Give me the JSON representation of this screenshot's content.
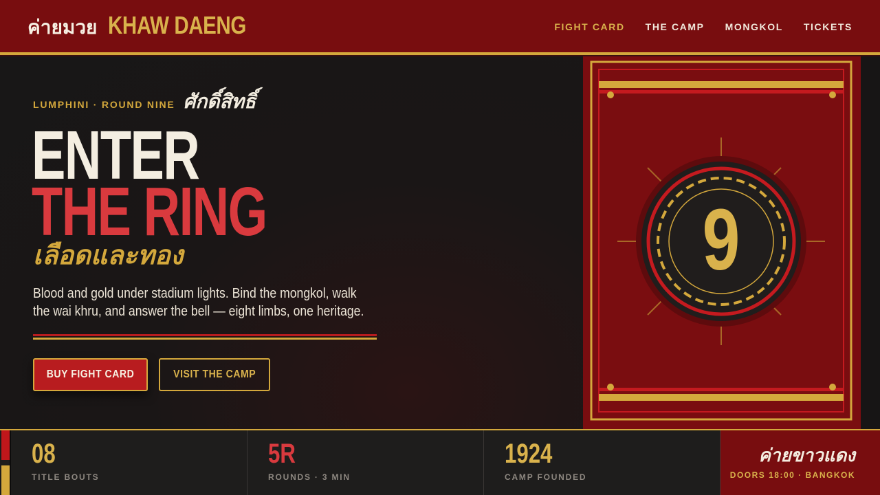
{
  "header": {
    "logo_thai": "ค่ายมวย",
    "logo_en": "KHAW DAENG",
    "nav": [
      {
        "label": "FIGHT CARD",
        "active": true
      },
      {
        "label": "THE CAMP",
        "active": false
      },
      {
        "label": "MONGKOL",
        "active": false
      },
      {
        "label": "TICKETS",
        "active": false
      }
    ]
  },
  "hero": {
    "kicker": "LUMPHINI · ROUND NINE",
    "kicker_thai": "ศักดิ์สิทธิ์",
    "title_line1": "ENTER",
    "title_line2": "THE RING",
    "title_thai": "เลือดและทอง",
    "lede": "Blood and gold under stadium lights. Bind the mongkol, walk the wai khru, and answer the bell — eight limbs, one heritage.",
    "buttons": {
      "primary": "BUY FIGHT CARD",
      "secondary": "VISIT THE CAMP"
    }
  },
  "card": {
    "round_number": "9"
  },
  "stats": [
    {
      "value": "08",
      "label": "TITLE BOUTS"
    },
    {
      "value": "5R",
      "label": "ROUNDS · 3 MIN"
    },
    {
      "value": "1924",
      "label": "CAMP FOUNDED"
    }
  ],
  "camp_panel": {
    "thai": "ค่ายขาวแดง",
    "info": "DOORS 18:00 · BANGKOK"
  },
  "colors": {
    "header_red": "#780d0f",
    "gold": "#d4a83c",
    "accent_red": "#d93a3e",
    "button_red": "#b81c1f",
    "background": "#181717"
  }
}
